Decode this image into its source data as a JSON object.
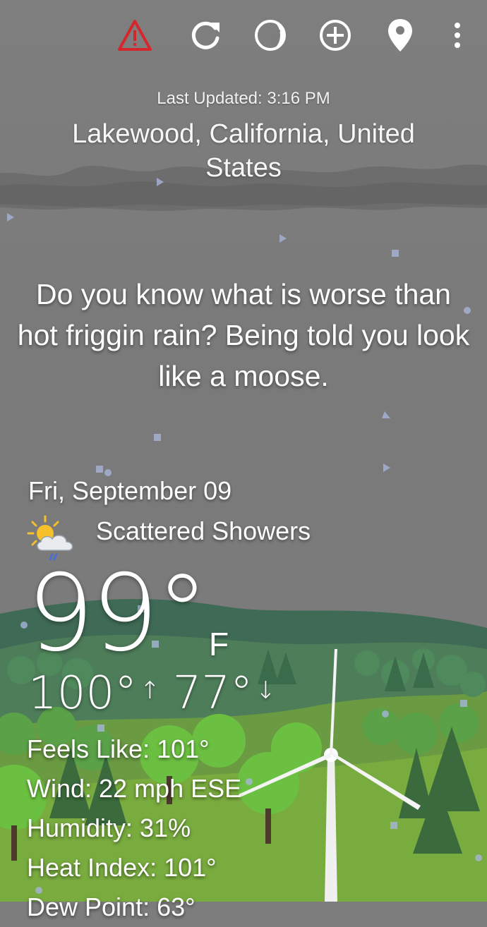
{
  "toolbar": {
    "alert_icon": "warning-triangle-icon",
    "refresh_icon": "refresh-icon",
    "theme_icon": "moon-phase-icon",
    "add_icon": "plus-circle-icon",
    "location_icon": "map-pin-icon",
    "menu_icon": "overflow-menu-icon",
    "alert_color": "#d6262b"
  },
  "header": {
    "last_updated": "Last Updated: 3:16 PM",
    "location": "Lakewood, California, United States"
  },
  "quote": "Do you know what is worse than hot friggin rain? Being told you look like a moose.",
  "weather": {
    "date": "Fri, September 09",
    "condition": "Scattered Showers",
    "condition_icon": "partly-cloudy-rain-icon",
    "temperature": "99°",
    "unit": "F",
    "high": "100°",
    "high_arrow": "↑",
    "low": "77°",
    "low_arrow": "↓"
  },
  "details": {
    "feels_like": "Feels Like:  101°",
    "wind": "Wind:  22 mph ESE",
    "humidity": "Humidity:  31%",
    "heat_index": "Heat Index:  101°",
    "dew_point": "Dew Point:  63°"
  }
}
